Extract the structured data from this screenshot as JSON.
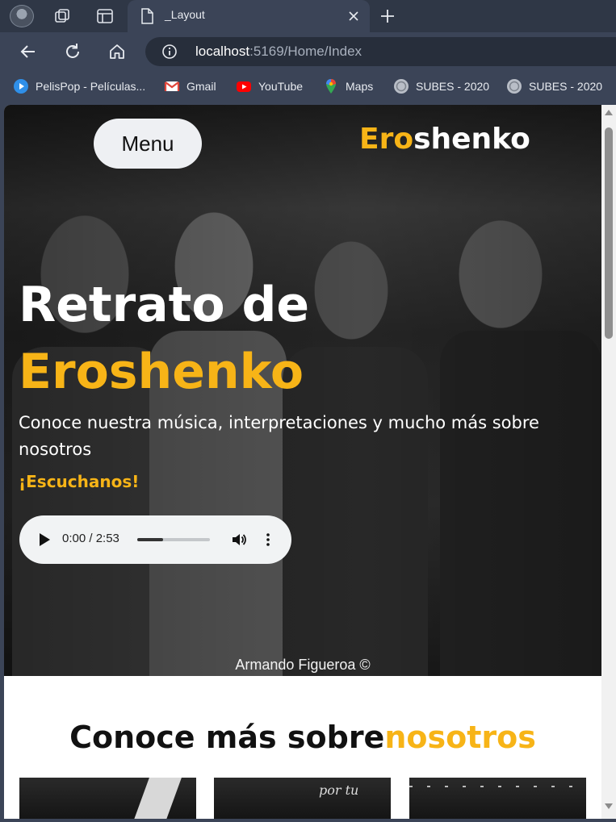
{
  "browser": {
    "tab_title": "_Layout",
    "url_host": "localhost",
    "url_rest": ":5169/Home/Index",
    "bookmarks": [
      {
        "label": "PelisPop - Películas...",
        "icon": "play-circle-icon"
      },
      {
        "label": "Gmail",
        "icon": "gmail-icon"
      },
      {
        "label": "YouTube",
        "icon": "youtube-icon"
      },
      {
        "label": "Maps",
        "icon": "maps-pin-icon"
      },
      {
        "label": "SUBES - 2020",
        "icon": "seal-icon"
      },
      {
        "label": "SUBES - 2020",
        "icon": "seal-icon"
      }
    ]
  },
  "page": {
    "menu_label": "Menu",
    "brand_accent": "Ero",
    "brand_rest": "shenko",
    "hero_title_line1": "Retrato de",
    "hero_title_line2": "Eroshenko",
    "hero_subtitle": "Conoce nuestra música, interpretaciones y mucho más sobre nosotros",
    "hero_cta": "¡Escuchanos!",
    "audio": {
      "time": "0:00 / 2:53",
      "progress": 0.35
    },
    "photo_credit": "Armando Figueroa ©",
    "about_title_main": "Conoce más sobre",
    "about_title_accent": "nosotros",
    "thumb_text": "por tu"
  },
  "colors": {
    "accent": "#f7b417",
    "chrome_dark": "#2f3746",
    "chrome": "#3b4457"
  }
}
